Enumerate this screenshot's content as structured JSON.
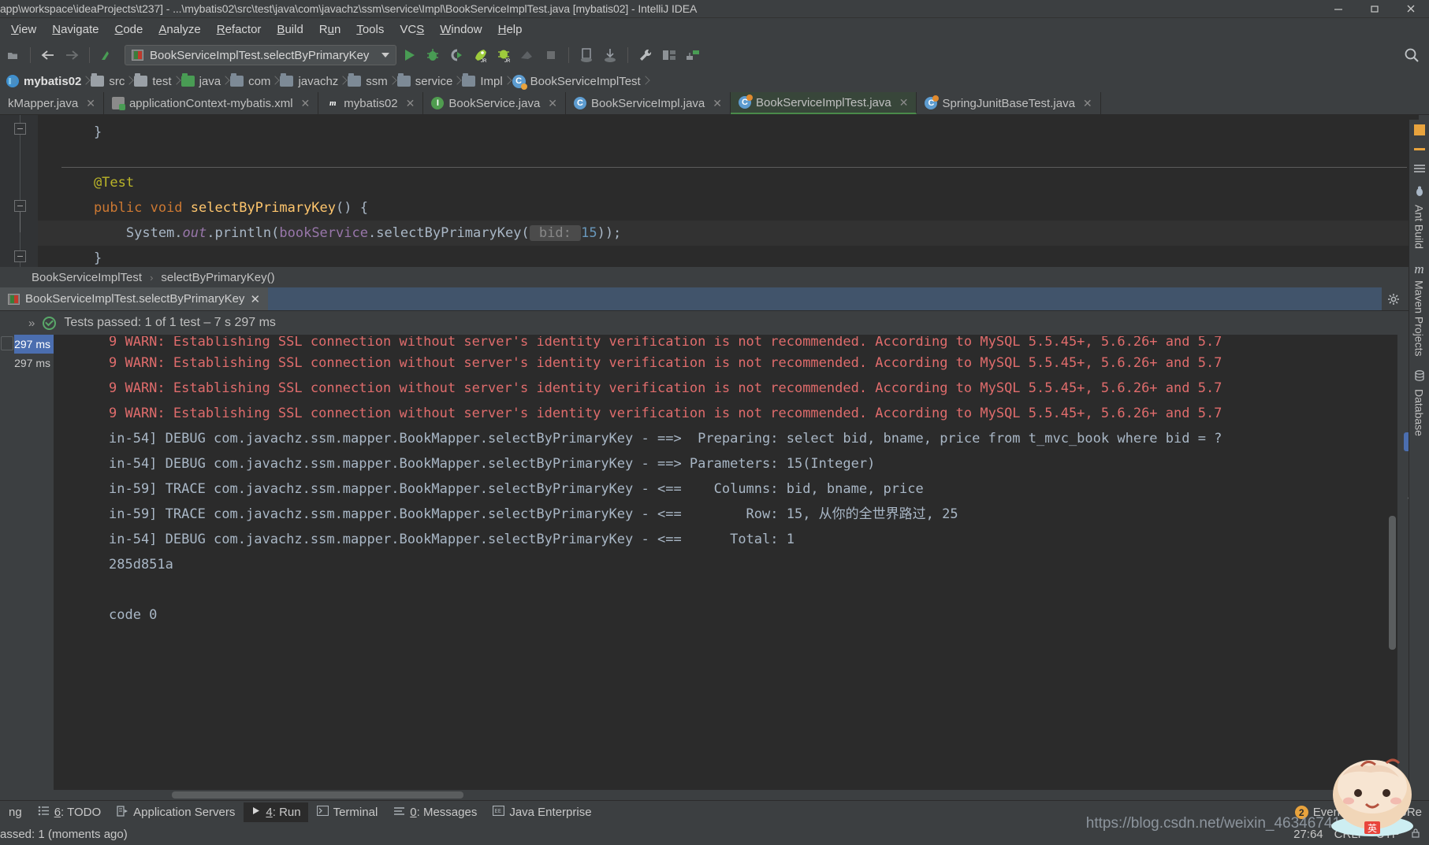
{
  "window": {
    "title": "app\\workspace\\ideaProjects\\t237] - ...\\mybatis02\\src\\test\\java\\com\\javachz\\ssm\\service\\Impl\\BookServiceImplTest.java [mybatis02] - IntelliJ IDEA",
    "minimize_label": "–",
    "maximize_label": "❐",
    "close_label": "✕"
  },
  "menu": {
    "items": [
      {
        "label": "View",
        "mnemonic": "V"
      },
      {
        "label": "Navigate",
        "mnemonic": "N"
      },
      {
        "label": "Code",
        "mnemonic": "C"
      },
      {
        "label": "Analyze",
        "mnemonic": "A"
      },
      {
        "label": "Refactor",
        "mnemonic": "R"
      },
      {
        "label": "Build",
        "mnemonic": "B"
      },
      {
        "label": "Run",
        "mnemonic": "u"
      },
      {
        "label": "Tools",
        "mnemonic": "T"
      },
      {
        "label": "VCS",
        "mnemonic": "S"
      },
      {
        "label": "Window",
        "mnemonic": "W"
      },
      {
        "label": "Help",
        "mnemonic": "H"
      }
    ]
  },
  "toolbar": {
    "run_configuration": "BookServiceImplTest.selectByPrimaryKey",
    "icons": [
      "back-icon",
      "forward-icon",
      "build-icon",
      "run-icon",
      "debug-icon",
      "run-with-coverage-icon",
      "jrebel-run-icon",
      "jrebel-debug-icon",
      "attach-profiler-icon",
      "stop-icon",
      "update-app-icon",
      "download-icon",
      "settings-wrench-icon",
      "project-structure-icon",
      "sync-gradle-icon",
      "search-everywhere-icon"
    ]
  },
  "breadcrumbs": {
    "items": [
      {
        "label": "mybatis02",
        "icon": "module-icon"
      },
      {
        "label": "src",
        "icon": "folder-icon"
      },
      {
        "label": "test",
        "icon": "folder-icon"
      },
      {
        "label": "java",
        "icon": "source-folder-icon"
      },
      {
        "label": "com",
        "icon": "package-icon"
      },
      {
        "label": "javachz",
        "icon": "package-icon"
      },
      {
        "label": "ssm",
        "icon": "package-icon"
      },
      {
        "label": "service",
        "icon": "package-icon"
      },
      {
        "label": "Impl",
        "icon": "package-icon"
      },
      {
        "label": "BookServiceImplTest",
        "icon": "test-class-icon"
      }
    ]
  },
  "editor_tabs": [
    {
      "label": "kMapper.java",
      "icon": "java-file-icon",
      "active": false,
      "clipped": true
    },
    {
      "label": "applicationContext-mybatis.xml",
      "icon": "xml-spring-file-icon",
      "active": false
    },
    {
      "label": "mybatis02",
      "icon": "maven-module-icon",
      "active": false
    },
    {
      "label": "BookService.java",
      "icon": "interface-icon",
      "active": false
    },
    {
      "label": "BookServiceImpl.java",
      "icon": "class-icon",
      "active": false
    },
    {
      "label": "BookServiceImplTest.java",
      "icon": "test-class-icon",
      "active": true
    },
    {
      "label": "SpringJunitBaseTest.java",
      "icon": "test-class-icon",
      "active": false
    }
  ],
  "editor": {
    "lines": [
      {
        "indent": 1,
        "tokens": [
          {
            "t": "}",
            "c": "pln"
          }
        ]
      },
      {
        "indent": 0,
        "tokens": []
      },
      {
        "indent": 1,
        "tokens": [
          {
            "t": "@Test",
            "c": "ann"
          }
        ]
      },
      {
        "indent": 1,
        "tokens": [
          {
            "t": "public ",
            "c": "kw"
          },
          {
            "t": "void ",
            "c": "kw"
          },
          {
            "t": "selectByPrimaryKey",
            "c": "mth"
          },
          {
            "t": "() {",
            "c": "pln"
          }
        ]
      },
      {
        "indent": 2,
        "highlight": true,
        "tokens": [
          {
            "t": "System.",
            "c": "pln"
          },
          {
            "t": "out",
            "c": "stat"
          },
          {
            "t": ".println(",
            "c": "pln"
          },
          {
            "t": "bookService",
            "c": "fld"
          },
          {
            "t": ".selectByPrimaryKey(",
            "c": "pln"
          },
          {
            "t": " bid: ",
            "c": "hint"
          },
          {
            "t": "15",
            "c": "num"
          },
          {
            "t": "));",
            "c": "pln"
          }
        ]
      },
      {
        "indent": 1,
        "tokens": [
          {
            "t": "}",
            "c": "pln"
          }
        ]
      }
    ],
    "breadcrumb": {
      "class": "BookServiceImplTest",
      "separator": "›",
      "method": "selectByPrimaryKey()"
    }
  },
  "run_window": {
    "tab_label": "BookServiceImplTest.selectByPrimaryKey",
    "tab_close": "✕",
    "settings_icon": "gear-icon",
    "hide_icon": "minimize-icon",
    "status_expand": "»",
    "status_text": "Tests passed: 1 of 1 test – 7 s 297 ms",
    "status_check": "passed-check-icon",
    "test_tree": [
      {
        "time": "297 ms",
        "selected": true
      },
      {
        "time": "297 ms",
        "selected": false
      }
    ],
    "left_toolbar_icons": [
      "rerun-icon",
      "rerun-failed-icon",
      "stop-icon"
    ],
    "right_toolbar_icons": [
      "scroll-up-icon",
      "scroll-down-icon",
      "wrap-text-icon",
      "scroll-to-end-icon",
      "print-icon",
      "clear-all-icon"
    ],
    "console_lines": [
      {
        "text": "9 WARN: Establishing SSL connection without server's identity verification is not recommended. According to MySQL 5.5.45+, 5.6.26+ and 5.7",
        "type": "warn",
        "clipped_top": true
      },
      {
        "text": "9 WARN: Establishing SSL connection without server's identity verification is not recommended. According to MySQL 5.5.45+, 5.6.26+ and 5.7",
        "type": "warn"
      },
      {
        "text": "9 WARN: Establishing SSL connection without server's identity verification is not recommended. According to MySQL 5.5.45+, 5.6.26+ and 5.7",
        "type": "warn"
      },
      {
        "text": "9 WARN: Establishing SSL connection without server's identity verification is not recommended. According to MySQL 5.5.45+, 5.6.26+ and 5.7",
        "type": "warn"
      },
      {
        "text": "in-54] DEBUG com.javachz.ssm.mapper.BookMapper.selectByPrimaryKey - ==>  Preparing: select bid, bname, price from t_mvc_book where bid = ?",
        "type": "info"
      },
      {
        "text": "in-54] DEBUG com.javachz.ssm.mapper.BookMapper.selectByPrimaryKey - ==> Parameters: 15(Integer)",
        "type": "info"
      },
      {
        "text": "in-59] TRACE com.javachz.ssm.mapper.BookMapper.selectByPrimaryKey - <==    Columns: bid, bname, price",
        "type": "info"
      },
      {
        "text": "in-59] TRACE com.javachz.ssm.mapper.BookMapper.selectByPrimaryKey - <==        Row: 15, 从你的全世界路过, 25",
        "type": "info"
      },
      {
        "text": "in-54] DEBUG com.javachz.ssm.mapper.BookMapper.selectByPrimaryKey - <==      Total: 1",
        "type": "info"
      },
      {
        "text": "285d851a",
        "type": "info"
      },
      {
        "text": "",
        "type": "info"
      },
      {
        "text": "code 0",
        "type": "info"
      }
    ]
  },
  "right_sidebar": [
    {
      "label": "Ant Build",
      "icon": "ant-icon"
    },
    {
      "label": "Maven Projects",
      "icon": "maven-icon"
    },
    {
      "label": "Database",
      "icon": "database-icon"
    }
  ],
  "status_tabs": [
    {
      "label": "ng",
      "icon": "",
      "clipped": true
    },
    {
      "label": "6: TODO",
      "mnemonic": "6",
      "icon": "todo-icon"
    },
    {
      "label": "Application Servers",
      "icon": "app-servers-icon"
    },
    {
      "label": "4: Run",
      "mnemonic": "4",
      "icon": "run-icon",
      "active": true
    },
    {
      "label": "Terminal",
      "icon": "terminal-icon"
    },
    {
      "label": "0: Messages",
      "mnemonic": "0",
      "icon": "messages-icon"
    },
    {
      "label": "Java Enterprise",
      "icon": "java-enterprise-icon"
    }
  ],
  "status_right": {
    "event_log_badge": "2",
    "event_log_label": "Event Log",
    "jrebel_label": "JRe",
    "caret_position": "27:64",
    "insert_mode": "CRLF",
    "encoding": "UTF"
  },
  "status_bottom": {
    "text": "assed: 1 (moments ago)"
  },
  "watermark": {
    "text": "https://blog.csdn.net/weixin_46346741"
  },
  "colors": {
    "accent_green": "#59a869",
    "warn_red": "#e06c6c",
    "selection_blue": "#4b6eaf",
    "editor_bg": "#2b2b2b",
    "chrome_bg": "#3c3f41"
  }
}
